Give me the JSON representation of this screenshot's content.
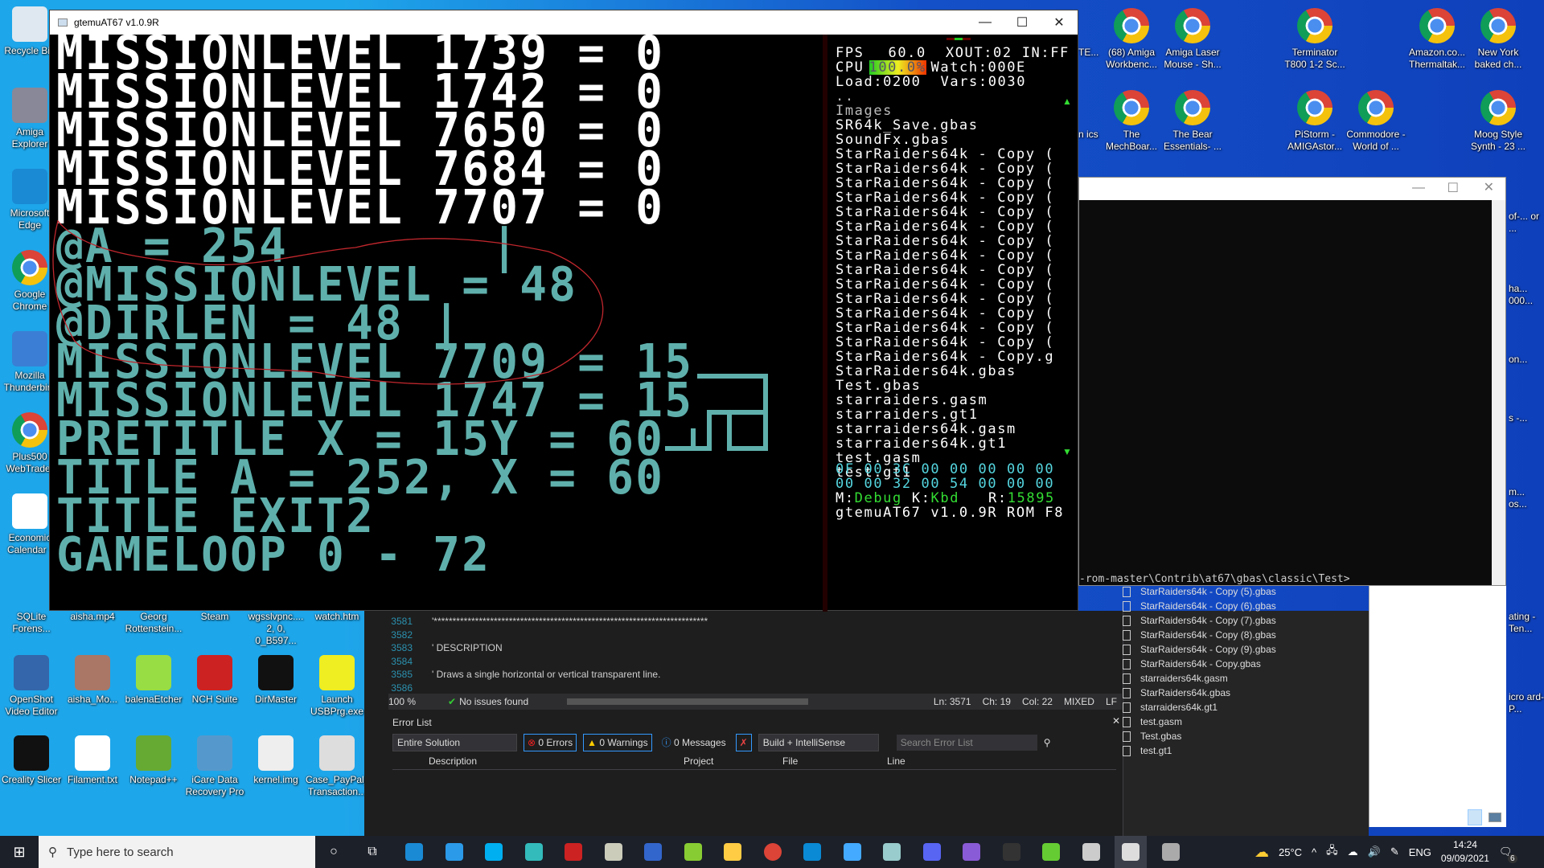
{
  "desktop": {
    "left_icons": [
      {
        "label": "Recycle Bin",
        "icon": "recycle-bin-icon"
      },
      {
        "label": "Amiga Explorer",
        "icon": "amiga-explorer-icon"
      },
      {
        "label": "Microsoft Edge",
        "icon": "edge-icon"
      },
      {
        "label": "Google Chrome",
        "icon": "chrome-icon"
      },
      {
        "label": "Mozilla Thunderbird",
        "icon": "thunderbird-icon"
      },
      {
        "label": "Plus500 WebTrader",
        "icon": "chrome-icon"
      },
      {
        "label": "Economic Calendar -",
        "icon": "fx-file-icon"
      }
    ],
    "bottom_icons": [
      {
        "label": "SQLite Forens...",
        "icon": "sqlite-icon"
      },
      {
        "label": "aisha.mp4",
        "icon": "video-icon"
      },
      {
        "label": "Georg Rottenstein...",
        "icon": "file-icon"
      },
      {
        "label": "Steam",
        "icon": "steam-icon"
      },
      {
        "label": "wgsslvpnc.... 2, 0, 0_B597...",
        "icon": "file-icon"
      },
      {
        "label": "watch.htm",
        "icon": "html-icon"
      },
      {
        "label": "OpenShot Video Editor",
        "icon": "openshot-icon"
      },
      {
        "label": "aisha_Mo...",
        "icon": "photo-icon"
      },
      {
        "label": "balenaEtcher",
        "icon": "balena-icon"
      },
      {
        "label": "NCH Suite",
        "icon": "nch-icon"
      },
      {
        "label": "DirMaster",
        "icon": "dirmaster-icon"
      },
      {
        "label": "Launch USBPrg.exe",
        "icon": "usbprg-icon"
      },
      {
        "label": "Creality Slicer",
        "icon": "creality-icon"
      },
      {
        "label": "Filament.txt",
        "icon": "text-file-icon"
      },
      {
        "label": "Notepad++",
        "icon": "notepadpp-icon"
      },
      {
        "label": "iCare Data Recovery Pro",
        "icon": "icare-icon"
      },
      {
        "label": "kernel.img",
        "icon": "disc-image-icon"
      },
      {
        "label": "Case_PayPal_ Transaction...",
        "icon": "edge-doc-icon"
      }
    ],
    "top_right_icons": [
      {
        "label": "(68) Amiga Workbenc..."
      },
      {
        "label": "Amiga Laser Mouse - Sh..."
      },
      {
        "label": "Terminator T800 1-2 Sc..."
      },
      {
        "label": "Amazon.co... Thermaltak..."
      },
      {
        "label": "New York baked ch..."
      },
      {
        "label": "The MechBoar..."
      },
      {
        "label": "The Bear Essentials- ..."
      },
      {
        "label": "PiStorm - AMIGAstor..."
      },
      {
        "label": "Commodore - World of ..."
      },
      {
        "label": "Moog Style Synth - 23 ..."
      }
    ],
    "partial_labels": [
      "TE...",
      "n ics",
      "of-... or ...",
      "ha... 000...",
      "on...",
      "s -...",
      "m... os...",
      "ating - Ten...",
      "icro ard-P..."
    ]
  },
  "emulator": {
    "title": "gtemuAT67 v1.0.9R",
    "lines": [
      {
        "text": "MISSIONLEVEL 1739 = 0",
        "color": "#ffffff"
      },
      {
        "text": "MISSIONLEVEL 1742 = 0",
        "color": "#ffffff"
      },
      {
        "text": "MISSIONLEVEL 7650 = 0",
        "color": "#ffffff"
      },
      {
        "text": "MISSIONLEVEL 7684 = 0",
        "color": "#ffffff"
      },
      {
        "text": "MISSIONLEVEL 7707 = 0",
        "color": "#ffffff"
      },
      {
        "text": "@A = 254       |",
        "color": "#5fb0ac"
      },
      {
        "text": "@MISSIONLEVEL = 48",
        "color": "#5fb0ac"
      },
      {
        "text": "@DIRLEN = 48 |",
        "color": "#5fb0ac"
      },
      {
        "text": "MISSIONLEVEL 7709 = 15",
        "color": "#5fb0ac"
      },
      {
        "text": "MISSIONLEVEL 1747 = 15",
        "color": "#5fb0ac"
      },
      {
        "text": "PRETITLE X = 15Y = 60",
        "color": "#5fb0ac"
      },
      {
        "text": "TITLE A = 252, X = 60",
        "color": "#5fb0ac"
      },
      {
        "text": "TITLE EXIT2",
        "color": "#5fb0ac"
      },
      {
        "text": "GAMELOOP 0 - 72",
        "color": "#5fb0ac"
      }
    ],
    "stats": {
      "fps_label": "FPS",
      "fps": "60.0",
      "xout": "XOUT:02",
      "in": "IN:FF",
      "cpu_label": "CPU",
      "cpu": "100.0%",
      "cpu_percent": 100,
      "watch": "Watch:000E",
      "load": "Load:0200",
      "vars": "Vars:0030"
    },
    "parent_dir": "..",
    "files": [
      "Images",
      "SR64k_Save.gbas",
      "SoundFx.gbas",
      "StarRaiders64k - Copy (",
      "StarRaiders64k - Copy (",
      "StarRaiders64k - Copy (",
      "StarRaiders64k - Copy (",
      "StarRaiders64k - Copy (",
      "StarRaiders64k - Copy (",
      "StarRaiders64k - Copy (",
      "StarRaiders64k - Copy (",
      "StarRaiders64k - Copy (",
      "StarRaiders64k - Copy (",
      "StarRaiders64k - Copy (",
      "StarRaiders64k - Copy (",
      "StarRaiders64k - Copy (",
      "StarRaiders64k - Copy (",
      "StarRaiders64k - Copy.g",
      "StarRaiders64k.gbas",
      "Test.gbas",
      "starraiders.gasm",
      "starraiders.gt1",
      "starraiders64k.gasm",
      "starraiders64k.gt1",
      "test.gasm",
      "test.gt1"
    ],
    "hex1": "0F 00 3C 00 00 00 00 00",
    "hex2": "00 00 32 00 54 00 00 00",
    "mode_label": "M:",
    "mode": "Debug",
    "kbd_label": "K:",
    "kbd": "Kbd",
    "r_label": "R:",
    "r": "15895",
    "version": "gtemuAT67 v1.0.9R ROM F8",
    "colors": {
      "accent_green": "#33dd33",
      "hex_cyan": "#55d6e0",
      "teal_text": "#5fb0ac",
      "annotation_red": "#c0272d"
    }
  },
  "console": {
    "prompt": "-rom-master\\Contrib\\at67\\gbas\\classic\\Test>"
  },
  "vs": {
    "code": [
      {
        "n": "3581",
        "t": "'*************************************************************************"
      },
      {
        "n": "3582",
        "t": ""
      },
      {
        "n": "3583",
        "t": "' DESCRIPTION"
      },
      {
        "n": "3584",
        "t": ""
      },
      {
        "n": "3585",
        "t": "' Draws a single horizontal or vertical transparent line."
      },
      {
        "n": "3586",
        "t": ""
      }
    ],
    "status": {
      "zoom": "100 %",
      "issues": "No issues found",
      "ln": "Ln: 3571",
      "ch": "Ch: 19",
      "col": "Col: 22",
      "encoding": "MIXED",
      "eol": "LF"
    },
    "error_list": {
      "title": "Error List",
      "scope": "Entire Solution",
      "errors": "0 Errors",
      "warnings": "0 Warnings",
      "messages": "0 Messages",
      "build": "Build + IntelliSense",
      "search_placeholder": "Search Error List",
      "columns": [
        "Description",
        "Project",
        "File",
        "Line"
      ]
    },
    "solution_files": [
      "StarRaiders64k - Copy (5).gbas",
      "StarRaiders64k - Copy (6).gbas",
      "StarRaiders64k - Copy (7).gbas",
      "StarRaiders64k - Copy (8).gbas",
      "StarRaiders64k - Copy (9).gbas",
      "StarRaiders64k - Copy.gbas",
      "starraiders64k.gasm",
      "StarRaiders64k.gbas",
      "starraiders64k.gt1",
      "test.gasm",
      "Test.gbas",
      "test.gt1"
    ]
  },
  "taskbar": {
    "search_placeholder": "Type here to search",
    "weather": "25°C",
    "language": "ENG",
    "time": "14:24",
    "date": "09/09/2021",
    "notifications": "6",
    "apps": [
      "edge-icon",
      "ie-icon",
      "skype-icon",
      "app-icon",
      "commodore-icon",
      "c64-icon",
      "app-icon",
      "app-icon",
      "file-explorer-icon",
      "chrome-icon",
      "store-icon",
      "app-icon",
      "app-icon",
      "discord-icon",
      "visual-studio-icon",
      "terminal-icon",
      "app-icon",
      "app-icon",
      "gtemu-icon",
      "app-icon"
    ]
  }
}
